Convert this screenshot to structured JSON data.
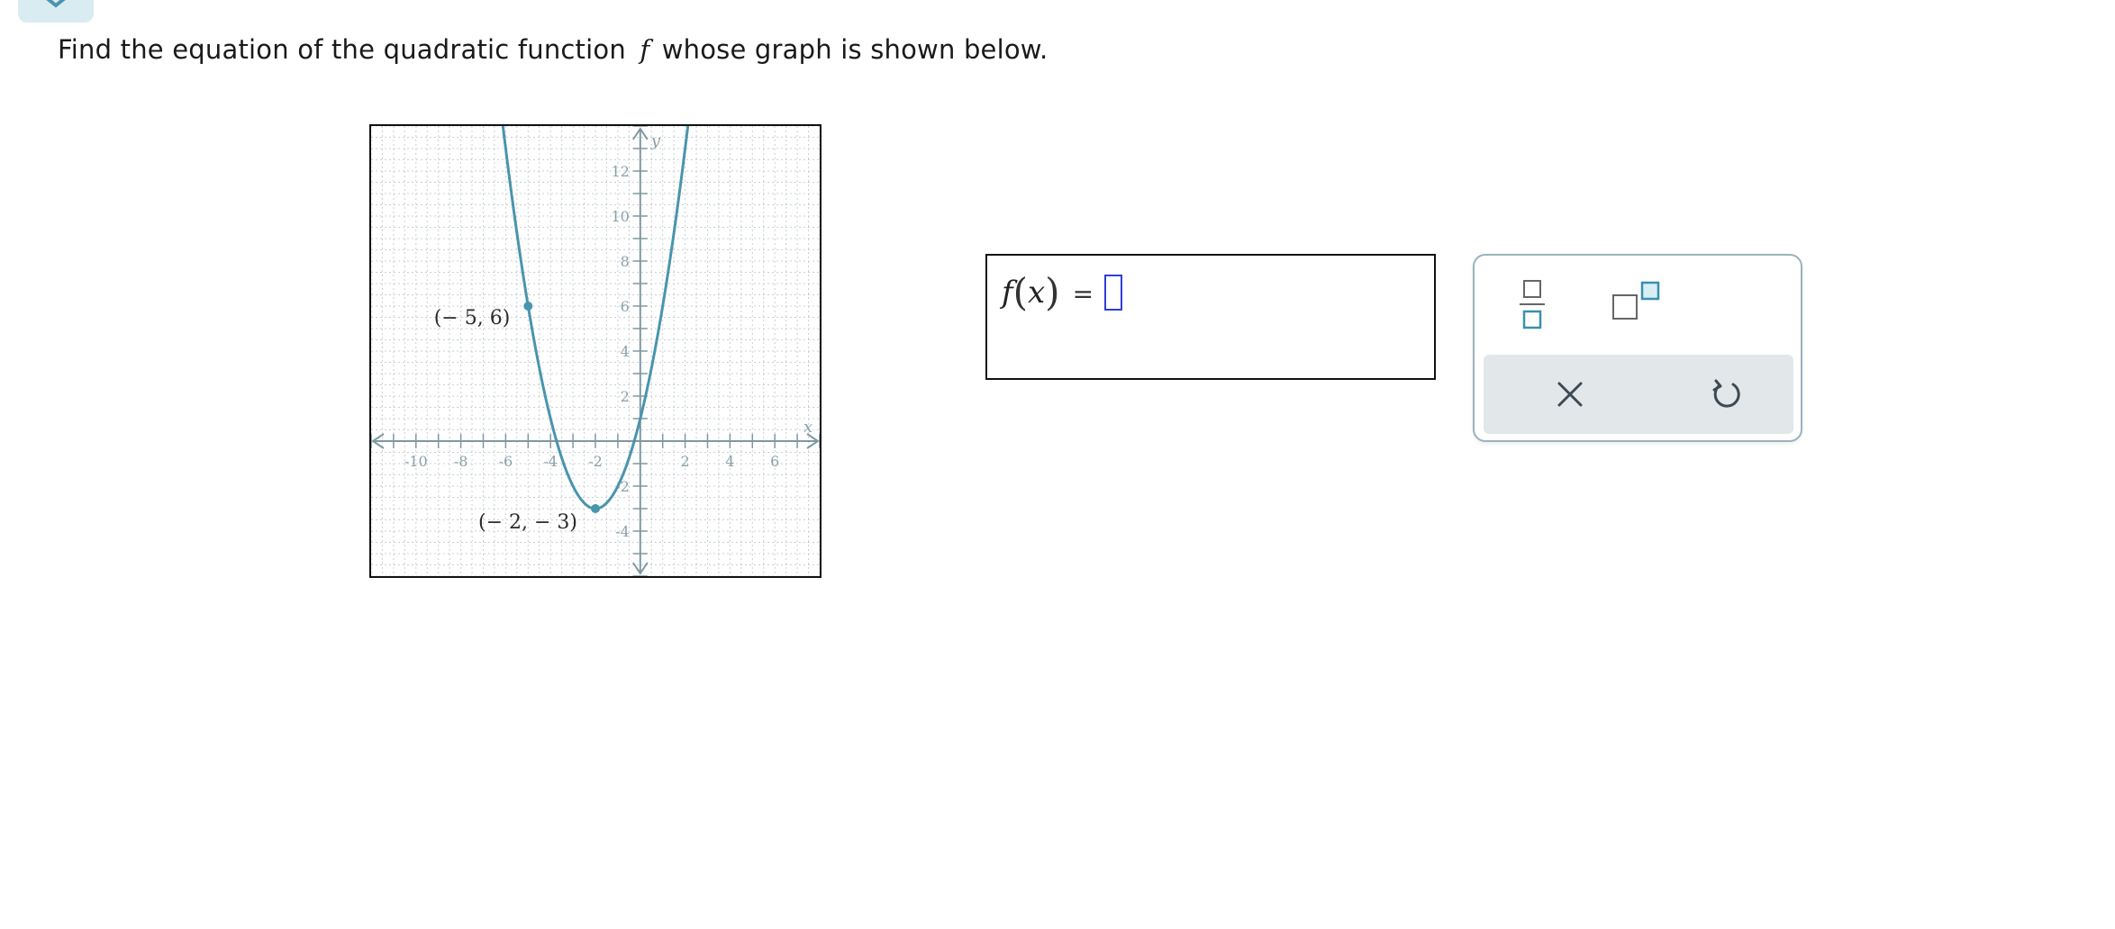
{
  "question": {
    "text_before": "Find the equation of the quadratic function",
    "function_name": "f",
    "text_after": "whose graph is shown below."
  },
  "graph": {
    "type": "line",
    "x_label": "x",
    "y_label": "y",
    "x_range": [
      -12,
      8
    ],
    "y_range": [
      -6,
      14
    ],
    "x_ticks": [
      -10,
      -8,
      -6,
      -4,
      -2,
      2,
      4,
      6
    ],
    "y_ticks": [
      -4,
      -2,
      2,
      4,
      6,
      8,
      10,
      12
    ],
    "grid": true,
    "curve_color": "#4a94ad",
    "axis_color": "#7f98a3",
    "points": [
      {
        "label": "(− 5, 6)",
        "x": -5,
        "y": 6
      },
      {
        "label": "(− 2, − 3)",
        "x": -2,
        "y": -3
      }
    ]
  },
  "answer": {
    "function_label": "f",
    "variable": "x",
    "equals": "=",
    "value": ""
  },
  "keypad": {
    "keys": [
      "fraction-icon",
      "exponent-icon"
    ],
    "actions": [
      "clear-icon",
      "undo-icon"
    ],
    "accent_color": "#3a8fb0"
  }
}
